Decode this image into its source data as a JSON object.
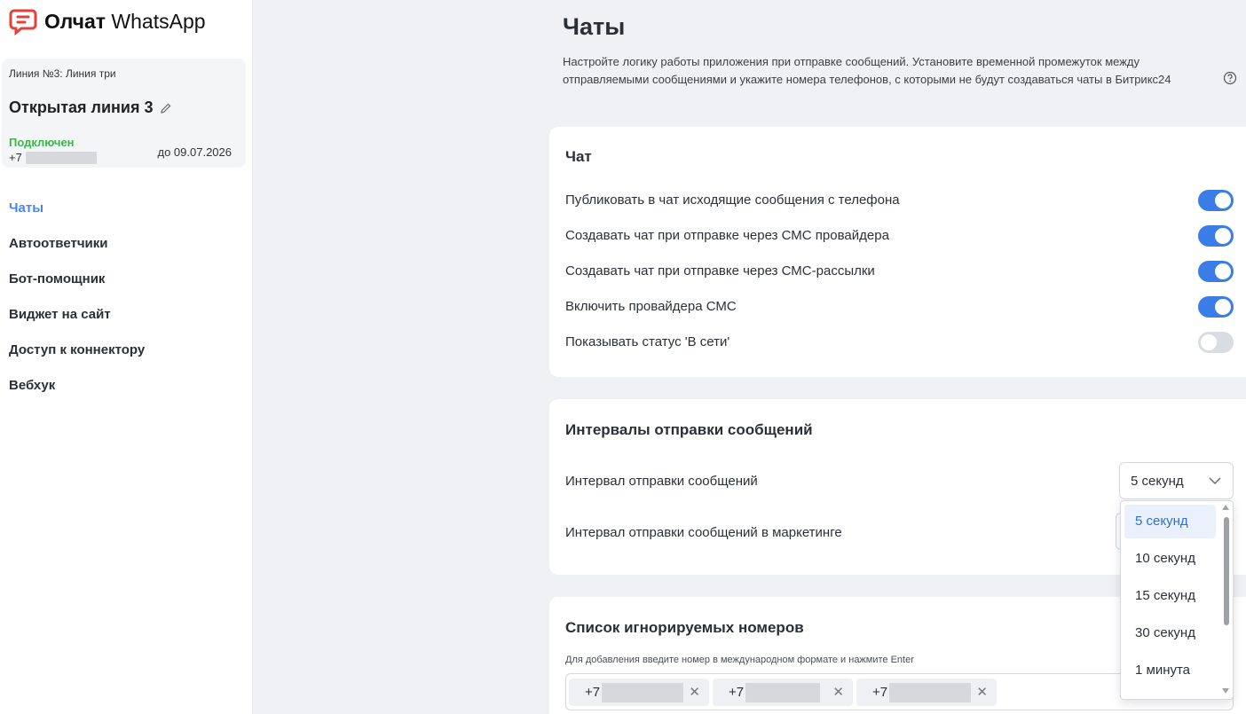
{
  "brand": {
    "name_bold": "Олчат",
    "name_rest": " WhatsApp",
    "accent": "#e5413a"
  },
  "line": {
    "subtitle": "Линия №3: Линия три",
    "title": "Открытая линия 3",
    "status": "Подключен",
    "phone_prefix": "+7",
    "expiry": "до 09.07.2026"
  },
  "nav": {
    "items": [
      {
        "label": "Чаты",
        "active": true
      },
      {
        "label": "Автоответчики"
      },
      {
        "label": "Бот-помощник"
      },
      {
        "label": "Виджет на сайт"
      },
      {
        "label": "Доступ к коннектору"
      },
      {
        "label": "Вебхук"
      }
    ]
  },
  "page": {
    "title": "Чаты",
    "description": "Настройте логику работы приложения при отправке сообщений. Установите временной промежуток между отправляемыми сообщениями и укажите номера телефонов, с которыми не будут создаваться чаты в Битрикс24"
  },
  "chat_section": {
    "title": "Чат",
    "settings": [
      {
        "label": "Публиковать в чат исходящие сообщения с телефона",
        "enabled": true
      },
      {
        "label": "Создавать чат при отправке через СМС провайдера",
        "enabled": true
      },
      {
        "label": "Создавать чат при отправке через СМС-рассылки",
        "enabled": true
      },
      {
        "label": "Включить провайдера СМС",
        "enabled": true
      },
      {
        "label": "Показывать статус 'В сети'",
        "enabled": false
      }
    ]
  },
  "intervals_section": {
    "title": "Интервалы отправки сообщений",
    "interval_label": "Интервал отправки сообщений",
    "interval_value": "5 секунд",
    "marketing_label": "Интервал отправки сообщений в маркетинге",
    "dropdown_options": [
      {
        "label": "5 секунд",
        "selected": true
      },
      {
        "label": "10 секунд"
      },
      {
        "label": "15 секунд"
      },
      {
        "label": "30 секунд"
      },
      {
        "label": "1 минута"
      }
    ]
  },
  "ignored_section": {
    "title": "Список игнорируемых номеров",
    "hint": "Для добавления введите номер в международном формате и нажмите Enter",
    "tags": [
      {
        "prefix": "+7"
      },
      {
        "prefix": "+7"
      },
      {
        "prefix": "+7"
      }
    ],
    "remove_symbol": "✕"
  },
  "colors": {
    "accent_blue": "#3a7de6",
    "status_green": "#3bb54a",
    "toggle_off": "#d9dde3"
  }
}
